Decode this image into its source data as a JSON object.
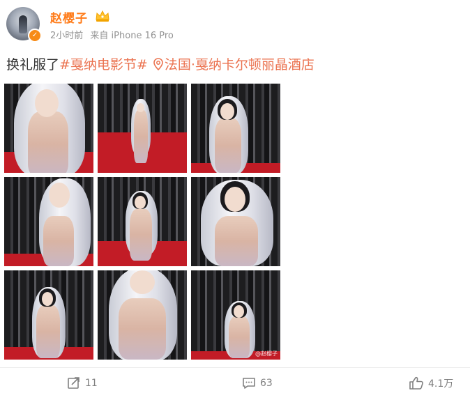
{
  "post": {
    "username": "赵樱子",
    "time": "2小时前",
    "source": "来自 iPhone 16 Pro",
    "text_prefix": "换礼服了",
    "hashtag": "#戛纳电影节#",
    "location": "法国·戛纳卡尔顿丽晶酒店"
  },
  "photos": [
    {
      "name": "photo-1",
      "desc": "closeup"
    },
    {
      "name": "photo-2",
      "desc": "full-body"
    },
    {
      "name": "photo-3",
      "desc": "portrait"
    },
    {
      "name": "photo-4",
      "desc": "closeup"
    },
    {
      "name": "photo-5",
      "desc": "full-body"
    },
    {
      "name": "photo-6",
      "desc": "portrait"
    },
    {
      "name": "photo-7",
      "desc": "full-body"
    },
    {
      "name": "photo-8",
      "desc": "closeup"
    },
    {
      "name": "photo-9",
      "desc": "full-body"
    }
  ],
  "watermark": "@赵樱子",
  "actions": {
    "repost_count": "11",
    "comment_count": "63",
    "like_count": "4.1万"
  },
  "colors": {
    "username": "#ff7c1a",
    "hashtag": "#eb7350",
    "verified_badge": "#f78b17",
    "carpet": "#c21c26"
  },
  "icons": [
    "crown-icon",
    "verified-icon",
    "location-icon",
    "repost-icon",
    "comment-icon",
    "like-icon"
  ]
}
